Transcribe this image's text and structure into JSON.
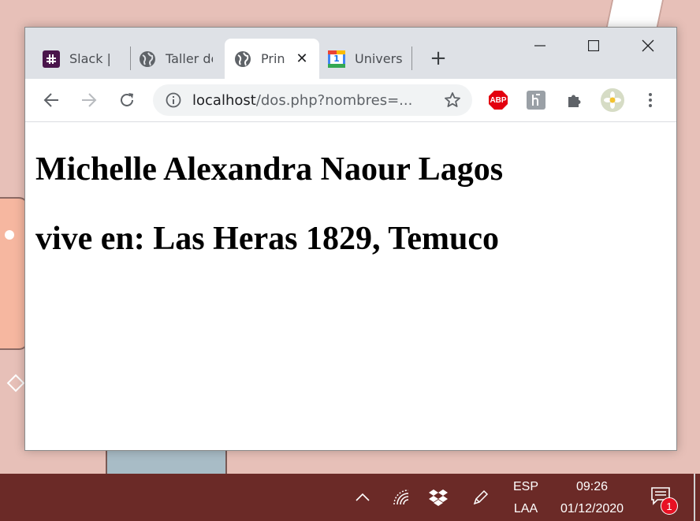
{
  "browser": {
    "tabs": [
      {
        "title": "Slack | C",
        "icon": "slack-icon",
        "active": false
      },
      {
        "title": "Taller de",
        "icon": "globe-icon",
        "active": false
      },
      {
        "title": "Prin",
        "icon": "globe-icon",
        "active": true
      },
      {
        "title": "Univers",
        "icon": "calendar-icon",
        "active": false
      }
    ],
    "calendar_icon_number": "1",
    "address_bar": {
      "host": "localhost",
      "path": "/dos.php?nombres=..."
    },
    "extensions": {
      "adblock_label": "ABP"
    },
    "accent_colors": {
      "adblock": "#e3000f",
      "slack": "#4a154b",
      "calendar_blue": "#4285f4"
    }
  },
  "page": {
    "line1": "Michelle Alexandra Naour Lagos",
    "line2": "vive en: Las Heras 1829, Temuco"
  },
  "taskbar": {
    "language_top": "ESP",
    "language_bottom": "LAA",
    "time": "09:26",
    "date": "01/12/2020",
    "notification_count": "1",
    "background_color": "#6b2a27"
  }
}
